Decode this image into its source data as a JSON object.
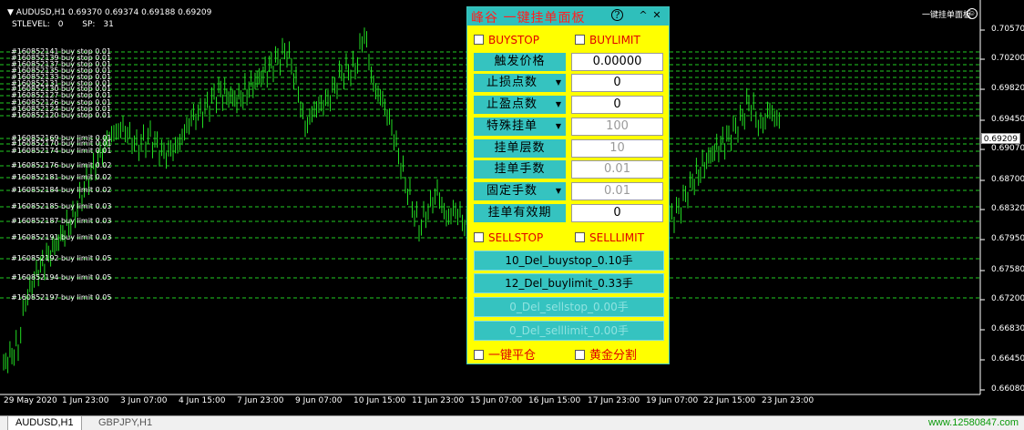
{
  "chart": {
    "symbol_header": "AUDUSD,H1  0.69370 0.69374 0.69188 0.69209",
    "stlevel_label": "STLEVEL:",
    "stlevel_value": "0",
    "sp_label": "SP:",
    "sp_value": "31",
    "current_price": "0.69209",
    "panel_shortcut_label": "一键挂单面板",
    "smiley": "☺",
    "y_ticks": [
      "0.70570",
      "0.70200",
      "0.69820",
      "0.69450",
      "0.69070",
      "0.68700",
      "0.68320",
      "0.67950",
      "0.67580",
      "0.67200",
      "0.66830",
      "0.66450",
      "0.66080"
    ],
    "x_ticks": [
      "29 May 2020",
      "1 Jun 23:00",
      "3 Jun 07:00",
      "4 Jun 15:00",
      "7 Jun 23:00",
      "9 Jun 07:00",
      "10 Jun 15:00",
      "11 Jun 23:00",
      "15 Jun 07:00",
      "16 Jun 15:00",
      "17 Jun 23:00",
      "19 Jun 07:00",
      "22 Jun 15:00",
      "23 Jun 23:00"
    ],
    "orders": [
      "#160852141 buy stop 0.01",
      "#160852139 buy stop 0.01",
      "#160852137 buy stop 0.01",
      "#160852135 buy stop 0.01",
      "#160852133 buy stop 0.01",
      "#160852131 buy stop 0.01",
      "#160852130 buy stop 0.01",
      "#160852127 buy stop 0.01",
      "#160852126 buy stop 0.01",
      "#160852124 buy stop 0.01",
      "#160852120 buy stop 0.01",
      "#160852169 buy limit 0.01",
      "#160852170 buy limit 0.01",
      "#160852174 buy limit 0.01",
      "#160852176 buy limit 0.02",
      "#160852181 buy limit 0.02",
      "#160852184 buy limit 0.02",
      "#160852185 buy limit 0.03",
      "#160852187 buy limit 0.03",
      "#160852191 buy limit 0.03",
      "#160852192 buy limit 0.05",
      "#160852194 buy limit 0.05",
      "#160852197 buy limit 0.05"
    ]
  },
  "panel": {
    "title": "峰谷 一键挂单面板",
    "help_icon": "?",
    "collapse_icon": "^",
    "close_icon": "✕",
    "buystop_label": "BUYSTOP",
    "buylimit_label": "BUYLIMIT",
    "rows": [
      {
        "label": "触发价格",
        "value": "0.00000",
        "combo": false,
        "disabled": false
      },
      {
        "label": "止损点数",
        "value": "0",
        "combo": true,
        "disabled": false
      },
      {
        "label": "止盈点数",
        "value": "0",
        "combo": true,
        "disabled": false
      },
      {
        "label": "特殊挂单",
        "value": "100",
        "combo": true,
        "disabled": true
      },
      {
        "label": "挂单层数",
        "value": "10",
        "combo": false,
        "disabled": true
      },
      {
        "label": "挂单手数",
        "value": "0.01",
        "combo": false,
        "disabled": true
      },
      {
        "label": "固定手数",
        "value": "0.01",
        "combo": true,
        "disabled": true
      },
      {
        "label": "挂单有效期",
        "value": "0",
        "combo": false,
        "disabled": false
      }
    ],
    "sellstop_label": "SELLSTOP",
    "selllimit_label": "SELLLIMIT",
    "del_buttons": [
      {
        "label": "10_Del_buystop_0.10手",
        "disabled": false
      },
      {
        "label": "12_Del_buylimit_0.33手",
        "disabled": false
      },
      {
        "label": "0_Del_sellstop_0.00手",
        "disabled": true
      },
      {
        "label": "0_Del_selllimit_0.00手",
        "disabled": true
      }
    ],
    "close_all_label": "一键平仓",
    "golden_split_label": "黄金分割"
  },
  "tabs": [
    "AUDUSD,H1",
    "GBPJPY,H1"
  ],
  "watermark": "www.12580847.com",
  "colors": {
    "candle": "#22dd22",
    "order_line": "#22cc22",
    "panel_bg": "#ffff00",
    "panel_button": "#35c3c0",
    "checkbox_text": "#e00000"
  }
}
